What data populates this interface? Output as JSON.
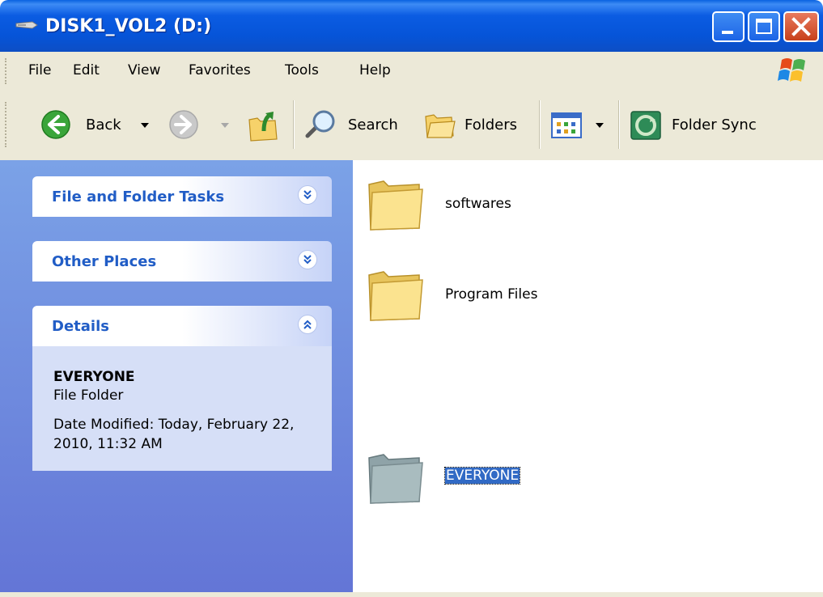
{
  "window": {
    "title": "DISK1_VOL2 (D:)",
    "title_icon": "drive-icon",
    "accent": "#0054e3",
    "close_color": "#c8401a"
  },
  "menu": [
    "File",
    "Edit",
    "View",
    "Favorites",
    "Tools",
    "Help"
  ],
  "toolbar": {
    "back_label": "Back",
    "search_label": "Search",
    "folders_label": "Folders",
    "sync_label": "Folder Sync"
  },
  "left_pane": {
    "file_tasks_title": "File and Folder Tasks",
    "other_places_title": "Other Places",
    "details_title": "Details",
    "details": {
      "name": "EVERYONE",
      "type": "File Folder",
      "date_modified": "Date Modified: Today, February 22, 2010, 11:32 AM"
    }
  },
  "files": [
    {
      "name": "softwares",
      "selected": false
    },
    {
      "name": "Program Files",
      "selected": false
    },
    {
      "name": "EVERYONE",
      "selected": true
    }
  ]
}
